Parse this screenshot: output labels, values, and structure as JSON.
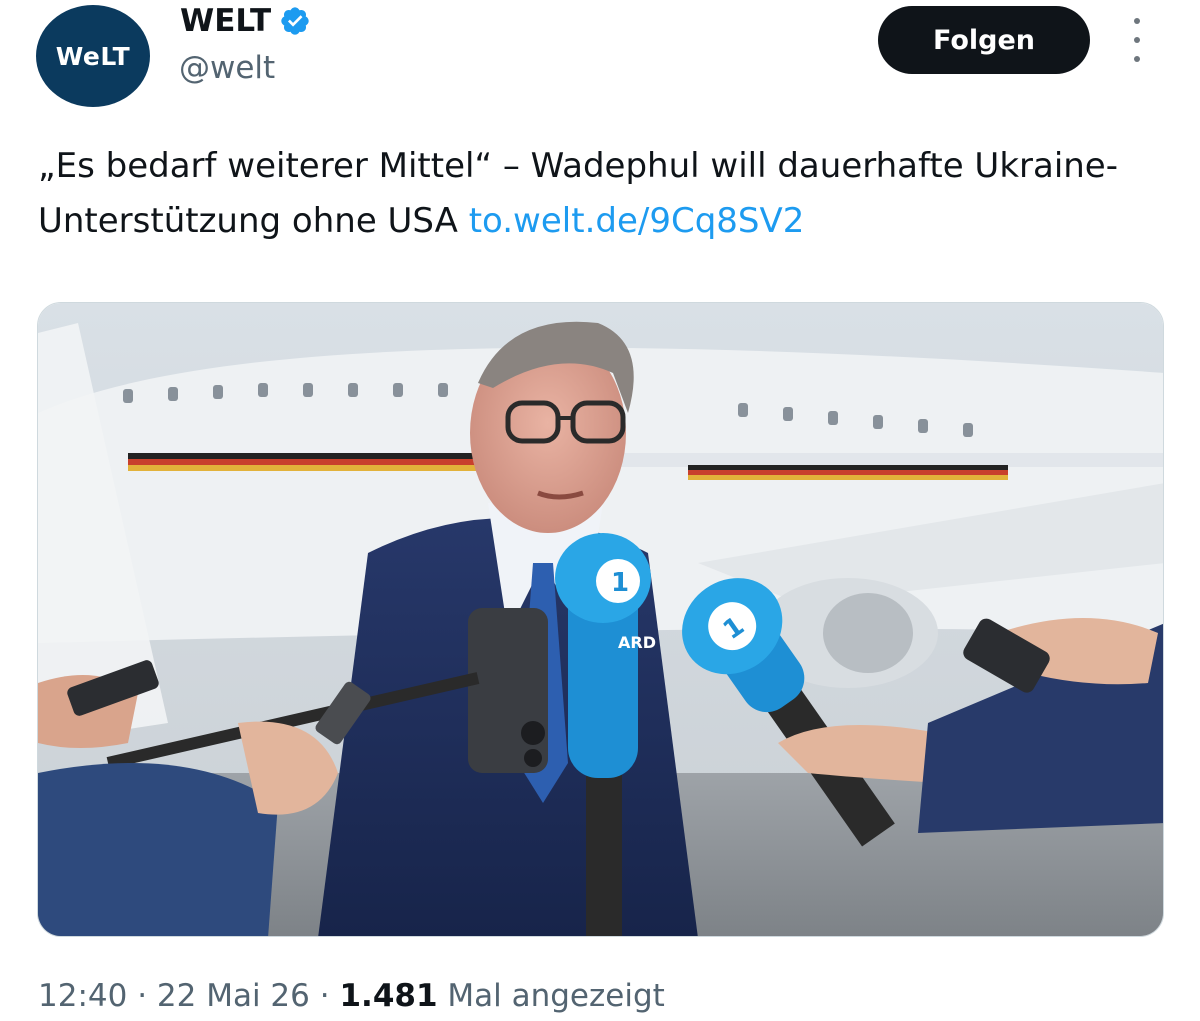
{
  "account": {
    "avatar_text": "WeLT",
    "name": "WELT",
    "handle": "@welt",
    "verified": true
  },
  "actions": {
    "follow_label": "Folgen"
  },
  "tweet": {
    "text": "„Es bedarf weiterer Mittel“ – Wadephul will dauerhafte Ukraine-Unterstützung ohne USA",
    "link": "to.welt.de/9Cq8SV2"
  },
  "media": {
    "alt_icons": [
      "microphone-icon",
      "phone-icon"
    ],
    "mic_label": "ARD"
  },
  "meta": {
    "time": "12:40",
    "separator": "·",
    "date": "22 Mai 26",
    "views_count": "1.481",
    "views_label": "Mal angezeigt"
  },
  "colors": {
    "brand": "#0b3a5e",
    "link": "#1d9bf0",
    "verified": "#1d9bf0",
    "secondary_text": "#536471"
  }
}
